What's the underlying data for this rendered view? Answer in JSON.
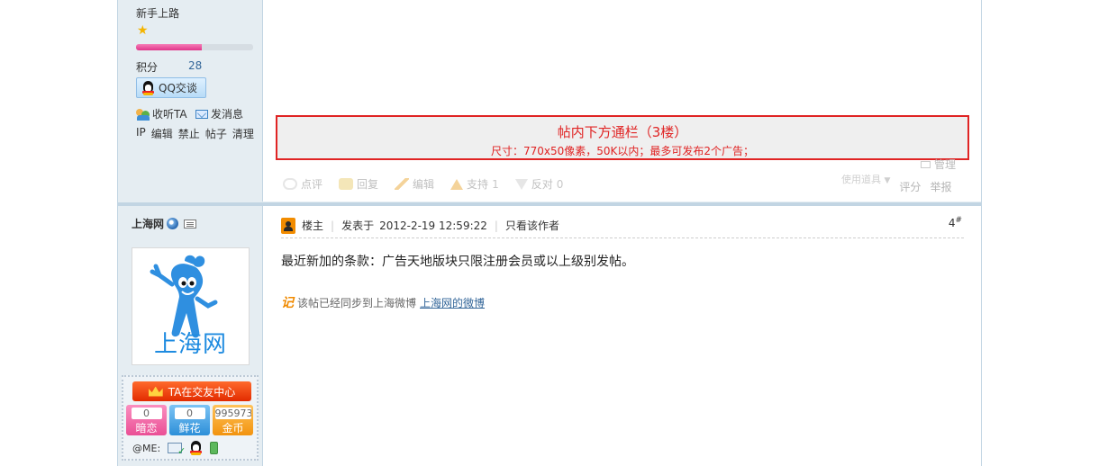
{
  "post1_author": {
    "rank": "新手上路",
    "exp_fraction": 0.56,
    "credits_label": "积分",
    "credits_value": "28",
    "qq_button": "QQ交谈",
    "follow_label": "收听TA",
    "message_label": "发消息",
    "admin_links": [
      "IP",
      "编辑",
      "禁止",
      "帖子",
      "清理"
    ]
  },
  "ad": {
    "title": "帖内下方通栏（3楼）",
    "subtitle": "尺寸：770x50像素，50K以内；最多可发布2个广告；"
  },
  "post1_actions": {
    "manage": "管理",
    "comment": "点评",
    "reply": "回复",
    "edit": "编辑",
    "support": "支持",
    "support_count": "1",
    "oppose": "反对",
    "oppose_count": "0",
    "tools": "使用道具",
    "rate": "评分",
    "report": "举报"
  },
  "post2_author": {
    "username": "上海网",
    "avatar_text": "上海网",
    "ta_center": "TA在交友中心",
    "counters": [
      {
        "value": "0",
        "label": "暗恋"
      },
      {
        "value": "0",
        "label": "鲜花"
      },
      {
        "value": "995973",
        "label": "金币"
      }
    ],
    "me_label": "@ME:"
  },
  "post2": {
    "owner_label": "楼主",
    "posted_prefix": "发表于",
    "posted_time": "2012-2-19 12:59:22",
    "only_author": "只看该作者",
    "floor": "4",
    "floor_mark": "#",
    "body": "最近新加的条款：广告天地版块只限注册会员或以上级别发帖。",
    "sync_icon": "记",
    "sync_text": "该帖已经同步到上海微博",
    "sync_link": "上海网的微博"
  },
  "colors": {
    "sidebar_bg": "#e5edf2",
    "border": "#c2d5e3",
    "ad_red": "#e02424",
    "link": "#336699"
  }
}
